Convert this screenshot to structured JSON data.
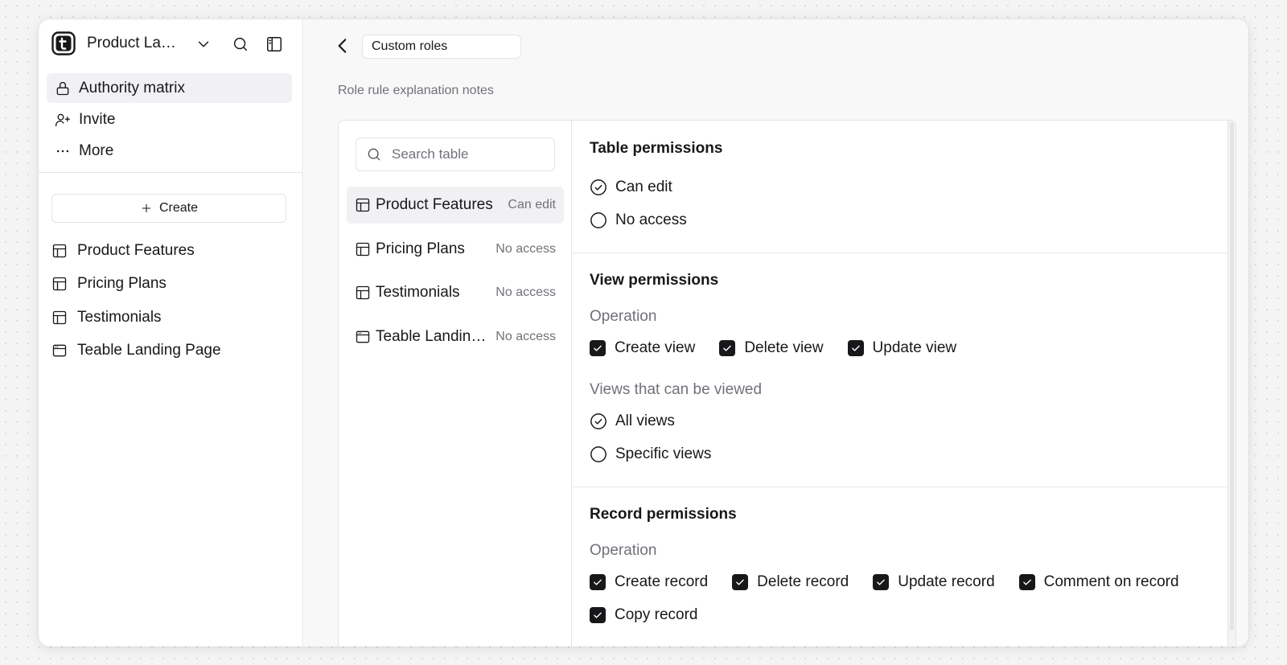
{
  "sidebar": {
    "space_name": "Product Launch",
    "nav": [
      {
        "label": "Authority matrix",
        "icon": "lock-icon",
        "active": true
      },
      {
        "label": "Invite",
        "icon": "user-plus-icon"
      },
      {
        "label": "More",
        "icon": "more-horizontal-icon"
      }
    ],
    "create_label": "Create",
    "tables": [
      {
        "label": "Product Features",
        "icon": "table-icon"
      },
      {
        "label": "Pricing Plans",
        "icon": "table-icon"
      },
      {
        "label": "Testimonials",
        "icon": "table-icon"
      },
      {
        "label": "Teable Landing Page",
        "icon": "app-window-icon"
      }
    ]
  },
  "main": {
    "role_name": "Custom roles",
    "description_placeholder": "Role rule explanation notes",
    "search_placeholder": "Search table",
    "table_list": [
      {
        "name": "Product Features",
        "access": "Can edit",
        "icon": "table-icon",
        "active": true
      },
      {
        "name": "Pricing Plans",
        "access": "No access",
        "icon": "table-icon"
      },
      {
        "name": "Testimonials",
        "access": "No access",
        "icon": "table-icon"
      },
      {
        "name": "Teable Landing Page",
        "access": "No access",
        "icon": "app-window-icon"
      }
    ],
    "table_permissions": {
      "title": "Table permissions",
      "options": [
        {
          "label": "Can edit",
          "selected": true
        },
        {
          "label": "No access",
          "selected": false
        }
      ]
    },
    "view_permissions": {
      "title": "View permissions",
      "operation_label": "Operation",
      "operations": [
        {
          "label": "Create view",
          "checked": true
        },
        {
          "label": "Delete view",
          "checked": true
        },
        {
          "label": "Update view",
          "checked": true
        }
      ],
      "viewable_label": "Views that can be viewed",
      "viewable_options": [
        {
          "label": "All views",
          "selected": true
        },
        {
          "label": "Specific views",
          "selected": false
        }
      ]
    },
    "record_permissions": {
      "title": "Record permissions",
      "operation_label": "Operation",
      "operations": [
        {
          "label": "Create record",
          "checked": true
        },
        {
          "label": "Delete record",
          "checked": true
        },
        {
          "label": "Update record",
          "checked": true
        },
        {
          "label": "Comment on record",
          "checked": true
        },
        {
          "label": "Copy record",
          "checked": true
        }
      ]
    }
  },
  "colors": {
    "accent": "#18181b",
    "muted_text": "#71717a",
    "border": "#e4e4e7",
    "active_bg": "#f1f1f3"
  }
}
